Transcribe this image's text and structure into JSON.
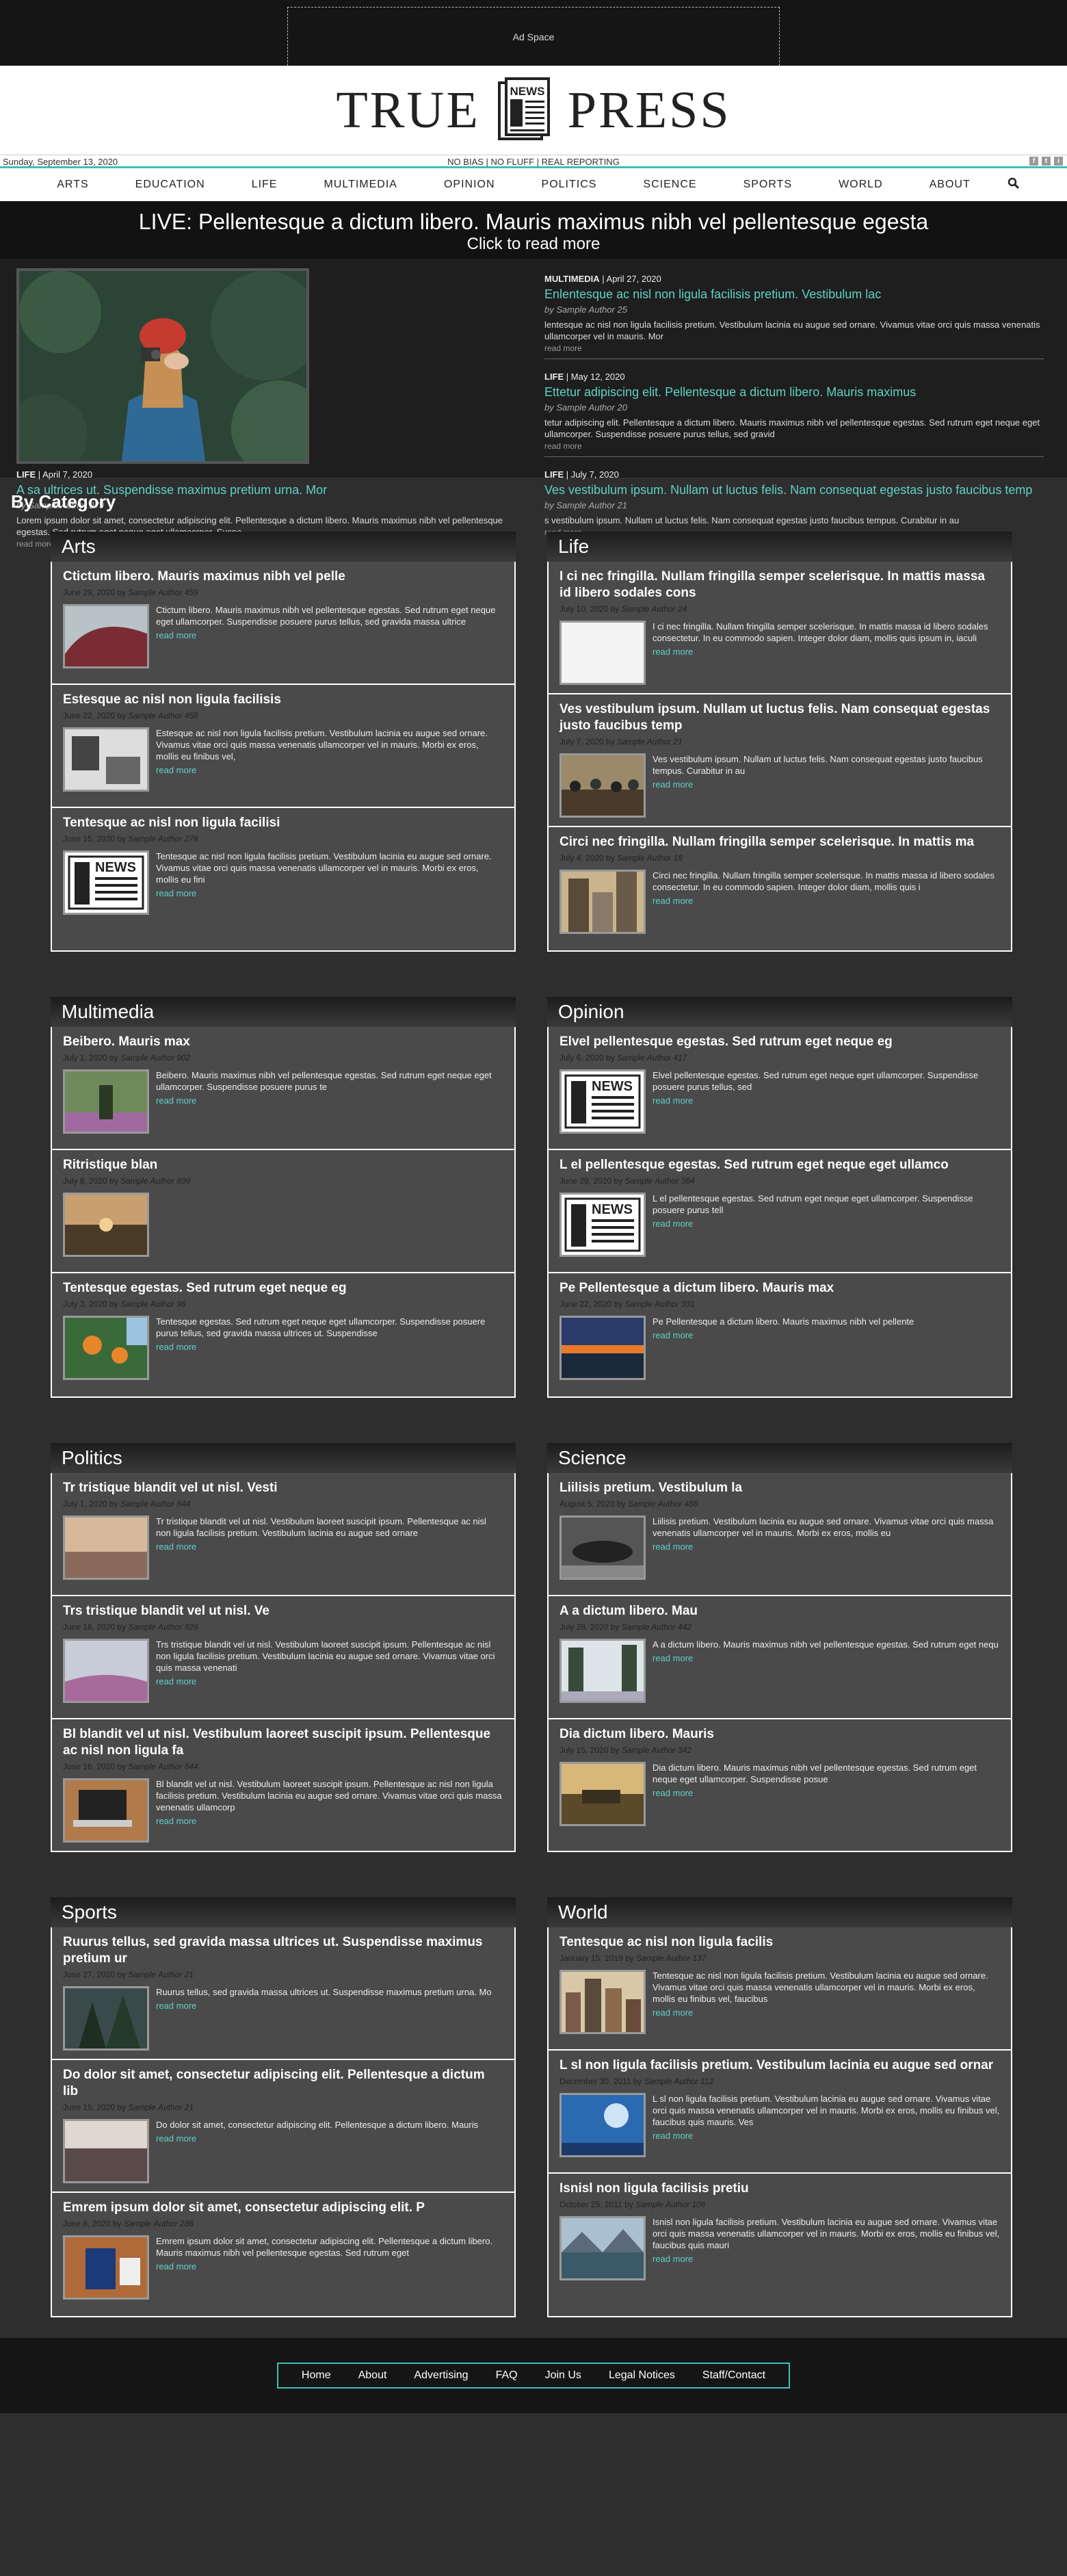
{
  "ad": {
    "label": "Ad Space"
  },
  "masthead": {
    "left": "TRUE",
    "right": "PRESS",
    "logo_text": "NEWS"
  },
  "datebar": {
    "date": "Sunday, September 13, 2020",
    "tagline": "NO BIAS | NO FLUFF | REAL REPORTING",
    "social": [
      "f",
      "t",
      "i"
    ]
  },
  "nav": {
    "items": [
      "ARTS",
      "EDUCATION",
      "LIFE",
      "MULTIMEDIA",
      "OPINION",
      "POLITICS",
      "SCIENCE",
      "SPORTS",
      "WORLD",
      "ABOUT"
    ],
    "search_icon": "search-icon"
  },
  "live": {
    "title": "LIVE: Pellentesque a dictum libero. Mauris maximus nibh vel pellentesque egesta",
    "sub": "Click to read more"
  },
  "feature": {
    "category": "LIFE",
    "date": "April 7, 2020",
    "title": "A sa ultrices ut. Suspendisse maximus pretium urna. Mor",
    "byline": "by Sample Author 279",
    "excerpt": "Lorem ipsum dolor sit amet, consectetur adipiscing elit. Pellentesque a dictum libero. Mauris maximus nibh vel pellentesque egestas. Sed rutrum eget neque eget ullamcorper. Suspe",
    "more": "read more"
  },
  "side_stories": [
    {
      "category": "MULTIMEDIA",
      "date": "April 27, 2020",
      "title": "Enlentesque ac nisl non ligula facilisis pretium. Vestibulum lac",
      "byline": "by Sample Author 25",
      "excerpt": "lentesque ac nisl non ligula facilisis pretium. Vestibulum lacinia eu augue sed ornare. Vivamus vitae orci quis massa venenatis ullamcorper vel in mauris. Mor",
      "more": "read more"
    },
    {
      "category": "LIFE",
      "date": "May 12, 2020",
      "title": "Ettetur adipiscing elit. Pellentesque a dictum libero. Mauris maximus",
      "byline": "by Sample Author 20",
      "excerpt": "tetur adipiscing elit. Pellentesque a dictum libero. Mauris maximus nibh vel pellentesque egestas. Sed rutrum eget neque eget ullamcorper. Suspendisse posuere purus tellus, sed gravid",
      "more": "read more"
    },
    {
      "category": "LIFE",
      "date": "July 7, 2020",
      "title": "Ves vestibulum ipsum. Nullam ut luctus felis. Nam consequat egestas justo faucibus temp",
      "byline": "by Sample Author 21",
      "excerpt": "s vestibulum ipsum. Nullam ut luctus felis. Nam consequat egestas justo faucibus tempus. Curabitur in au",
      "more": "read more"
    }
  ],
  "by_category": "By Category",
  "categories": [
    {
      "name": "Arts",
      "items": [
        {
          "title": "Ctictum libero. Mauris maximus nibh vel pelle",
          "date": "June 29, 2020",
          "author": "Sample Author 459",
          "text": "Ctictum libero. Mauris maximus nibh vel pellentesque egestas. Sed rutrum eget neque eget ullamcorper. Suspendisse posuere purus tellus, sed gravida massa ultrice",
          "more": "read more",
          "thumb": "red-hill"
        },
        {
          "title": "Estesque ac nisl non ligula facilisis",
          "date": "June 22, 2020",
          "author": "Sample Author 458",
          "text": "Estesque ac nisl non ligula facilisis pretium. Vestibulum lacinia eu augue sed ornare. Vivamus vitae orci quis massa venenatis ullamcorper vel in mauris. Morbi ex eros, mollis eu finibus vel,",
          "more": "read more",
          "thumb": "room"
        },
        {
          "title": "Tentesque ac nisl non ligula facilisi",
          "date": "June 15, 2020",
          "author": "Sample Author 278",
          "text": "Tentesque ac nisl non ligula facilisis pretium. Vestibulum lacinia eu augue sed ornare. Vivamus vitae orci quis massa venenatis ullamcorper vel in mauris. Morbi ex eros, mollis eu fini",
          "more": "read more",
          "thumb": "news"
        }
      ]
    },
    {
      "name": "Life",
      "items": [
        {
          "title": "I ci nec fringilla. Nullam fringilla semper scelerisque. In mattis massa id libero sodales cons",
          "date": "July 10, 2020",
          "author": "Sample Author 24",
          "text": "I ci nec fringilla. Nullam fringilla semper scelerisque. In mattis massa id libero sodales consectetur. In eu commodo sapien. Integer dolor diam, mollis quis ipsum in, iaculi",
          "more": "read more",
          "thumb": "white"
        },
        {
          "title": "Ves vestibulum ipsum. Nullam ut luctus felis. Nam consequat egestas justo faucibus temp",
          "date": "July 7, 2020",
          "author": "Sample Author 21",
          "text": "Ves vestibulum ipsum. Nullam ut luctus felis. Nam consequat egestas justo faucibus tempus. Curabitur in au",
          "more": "read more",
          "thumb": "crowd"
        },
        {
          "title": "Circi nec fringilla. Nullam fringilla semper scelerisque. In mattis ma",
          "date": "July 4, 2020",
          "author": "Sample Author 18",
          "text": "Circi nec fringilla. Nullam fringilla semper scelerisque. In mattis massa id libero sodales consectetur. In eu commodo sapien. Integer dolor diam, mollis quis i",
          "more": "read more",
          "thumb": "city"
        }
      ]
    },
    {
      "name": "Multimedia",
      "items": [
        {
          "title": "Beibero. Mauris max",
          "date": "July 1, 2020",
          "author": "Sample Author 902",
          "text": "Beibero. Mauris maximus nibh vel pellentesque egestas. Sed rutrum eget neque eget ullamcorper. Suspendisse posuere purus te",
          "more": "read more",
          "thumb": "forest"
        },
        {
          "title": "Ritristique blan",
          "date": "July 8, 2020",
          "author": "Sample Author 899",
          "text": "",
          "more": "",
          "thumb": "dusk"
        },
        {
          "title": "Tentesque egestas. Sed rutrum eget neque eg",
          "date": "July 3, 2020",
          "author": "Sample Author 96",
          "text": "Tentesque egestas. Sed rutrum eget neque eget ullamcorper. Suspendisse posuere purus tellus, sed gravida massa ultrices ut. Suspendisse",
          "more": "read more",
          "thumb": "oranges"
        }
      ]
    },
    {
      "name": "Opinion",
      "items": [
        {
          "title": "Elvel pellentesque egestas. Sed rutrum eget neque eg",
          "date": "July 6, 2020",
          "author": "Sample Author 417",
          "text": "Elvel pellentesque egestas. Sed rutrum eget neque eget ullamcorper. Suspendisse posuere purus tellus, sed",
          "more": "read more",
          "thumb": "news"
        },
        {
          "title": "L el pellentesque egestas. Sed rutrum eget neque eget ullamco",
          "date": "June 29, 2020",
          "author": "Sample Author 384",
          "text": "L el pellentesque egestas. Sed rutrum eget neque eget ullamcorper. Suspendisse posuere purus tell",
          "more": "read more",
          "thumb": "news"
        },
        {
          "title": "Pe Pellentesque a dictum libero. Mauris max",
          "date": "June 22, 2020",
          "author": "Sample Author 331",
          "text": "Pe Pellentesque a dictum libero. Mauris maximus nibh vel pellente",
          "more": "read more",
          "thumb": "sunset"
        }
      ]
    },
    {
      "name": "Politics",
      "items": [
        {
          "title": "Tr tristique blandit vel ut nisl. Vesti",
          "date": "July 1, 2020",
          "author": "Sample Author 844",
          "text": "Tr tristique blandit vel ut nisl. Vestibulum laoreet suscipit ipsum. Pellentesque ac nisl non ligula facilisis pretium. Vestibulum lacinia eu augue sed ornare",
          "more": "read more",
          "thumb": "beach"
        },
        {
          "title": "Trs tristique blandit vel ut nisl. Ve",
          "date": "June 16, 2020",
          "author": "Sample Author 826",
          "text": "Trs tristique blandit vel ut nisl. Vestibulum laoreet suscipit ipsum. Pellentesque ac nisl non ligula facilisis pretium. Vestibulum lacinia eu augue sed ornare. Vivamus vitae orci quis massa venenati",
          "more": "read more",
          "thumb": "fog"
        },
        {
          "title": "Bl blandit vel ut nisl. Vestibulum laoreet suscipit ipsum. Pellentesque ac nisl non ligula fa",
          "date": "June 16, 2020",
          "author": "Sample Author 844",
          "text": "Bl blandit vel ut nisl. Vestibulum laoreet suscipit ipsum. Pellentesque ac nisl non ligula facilisis pretium. Vestibulum lacinia eu augue sed ornare. Vivamus vitae orci quis massa venenatis ullamcorp",
          "more": "read more",
          "thumb": "laptop"
        }
      ]
    },
    {
      "name": "Science",
      "items": [
        {
          "title": "Liilisis pretium. Vestibulum la",
          "date": "August 5, 2020",
          "author": "Sample Author 488",
          "text": "Liilisis pretium. Vestibulum lacinia eu augue sed ornare. Vivamus vitae orci quis massa venenatis ullamcorper vel in mauris. Morbi ex eros, mollis eu",
          "more": "read more",
          "thumb": "car"
        },
        {
          "title": "A a dictum libero. Mau",
          "date": "July 28, 2020",
          "author": "Sample Author 442",
          "text": "A a dictum libero. Mauris maximus nibh vel pellentesque egestas. Sed rutrum eget nequ",
          "more": "read more",
          "thumb": "trees"
        },
        {
          "title": "Dia dictum libero. Mauris",
          "date": "July 15, 2020",
          "author": "Sample Author 342",
          "text": "Dia dictum libero. Mauris maximus nibh vel pellentesque egestas. Sed rutrum eget neque eget ullamcorper. Suspendisse posue",
          "more": "read more",
          "thumb": "tank"
        }
      ]
    },
    {
      "name": "Sports",
      "items": [
        {
          "title": "Ruurus tellus, sed gravida massa ultrices ut. Suspendisse maximus pretium ur",
          "date": "June 27, 2020",
          "author": "Sample Author 21",
          "text": "Ruurus tellus, sed gravida massa ultrices ut. Suspendisse maximus pretium urna. Mo",
          "more": "read more",
          "thumb": "pine"
        },
        {
          "title": "Do dolor sit amet, consectetur adipiscing elit. Pellentesque a dictum lib",
          "date": "June 15, 2020",
          "author": "Sample Author 21",
          "text": "Do dolor sit amet, consectetur adipiscing elit. Pellentesque a dictum libero. Mauris",
          "more": "read more",
          "thumb": "shore"
        },
        {
          "title": "Emrem ipsum dolor sit amet, consectetur adipiscing elit. P",
          "date": "June 8, 2020",
          "author": "Sample Author 286",
          "text": "Emrem ipsum dolor sit amet, consectetur adipiscing elit. Pellentesque a dictum libero. Mauris maximus nibh vel pellentesque egestas. Sed rutrum eget",
          "more": "read more",
          "thumb": "desk"
        }
      ]
    },
    {
      "name": "World",
      "items": [
        {
          "title": "Tentesque ac nisl non ligula facilis",
          "date": "January 15, 2019",
          "author": "Sample Author 137",
          "text": "Tentesque ac nisl non ligula facilisis pretium. Vestibulum lacinia eu augue sed ornare. Vivamus vitae orci quis massa venenatis ullamcorper vel in mauris. Morbi ex eros, mollis eu finibus vel, faucibus",
          "more": "read more",
          "thumb": "city2"
        },
        {
          "title": "L sl non ligula facilisis pretium. Vestibulum lacinia eu augue sed ornar",
          "date": "December 30, 2011",
          "author": "Sample Author 112",
          "text": "L sl non ligula facilisis pretium. Vestibulum lacinia eu augue sed ornare. Vivamus vitae orci quis massa venenatis ullamcorper vel in mauris. Morbi ex eros, mollis eu finibus vel, faucibus quis mauris. Ves",
          "more": "read more",
          "thumb": "bluesky"
        },
        {
          "title": "Isnisl non ligula facilisis pretiu",
          "date": "October 25, 2011",
          "author": "Sample Author 106",
          "text": "Isnisl non ligula facilisis pretium. Vestibulum lacinia eu augue sed ornare. Vivamus vitae orci quis massa venenatis ullamcorper vel in mauris. Morbi ex eros, mollis eu finibus vel, faucibus quis mauri",
          "more": "read more",
          "thumb": "lake"
        }
      ]
    }
  ],
  "footer": {
    "items": [
      "Home",
      "About",
      "Advertising",
      "FAQ",
      "Join Us",
      "Legal Notices",
      "Staff/Contact"
    ]
  }
}
